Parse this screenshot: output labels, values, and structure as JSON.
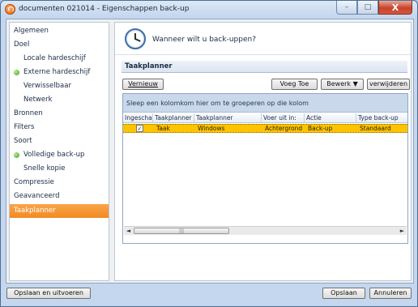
{
  "window": {
    "title": "documenten 021014 - Eigenschappen back-up",
    "minimize_glyph": "–",
    "maximize_glyph": "□",
    "close_glyph": "X"
  },
  "sidebar": {
    "items": [
      {
        "label": "Algemeen",
        "indent": false,
        "dot": false,
        "active": false
      },
      {
        "label": "Doel",
        "indent": false,
        "dot": false,
        "active": false
      },
      {
        "label": "Locale hardeschijf",
        "indent": true,
        "dot": false,
        "active": false
      },
      {
        "label": "Externe hardeschijf",
        "indent": true,
        "dot": true,
        "active": false
      },
      {
        "label": "Verwisselbaar",
        "indent": true,
        "dot": false,
        "active": false
      },
      {
        "label": "Netwerk",
        "indent": true,
        "dot": false,
        "active": false
      },
      {
        "label": "Bronnen",
        "indent": false,
        "dot": false,
        "active": false
      },
      {
        "label": "Filters",
        "indent": false,
        "dot": false,
        "active": false
      },
      {
        "label": "Soort",
        "indent": false,
        "dot": false,
        "active": false
      },
      {
        "label": "Volledige back-up",
        "indent": true,
        "dot": true,
        "active": false
      },
      {
        "label": "Snelle kopie",
        "indent": true,
        "dot": false,
        "active": false
      },
      {
        "label": "Compressie",
        "indent": false,
        "dot": false,
        "active": false
      },
      {
        "label": "Geavanceerd",
        "indent": false,
        "dot": false,
        "active": false
      },
      {
        "label": "Taakplanner",
        "indent": false,
        "dot": false,
        "active": true
      }
    ]
  },
  "main": {
    "question": "Wanneer wilt u back-uppen?",
    "section_title": "Taakplanner",
    "refresh_button": "Vernieuw",
    "add_button": "Voeg Toe",
    "edit_button": "Bewerk",
    "edit_arrow": "▼",
    "delete_button": "verwijderen",
    "group_hint": "Sleep een kolomkom hier om te groeperen op die kolom",
    "columns": [
      "Ingeschak",
      "Taakplanner",
      "Taakplanner",
      "Voer uit in:",
      "Actie",
      "Type back-up"
    ],
    "rows": [
      {
        "checked": "✓",
        "cells": [
          "Taak",
          "Windows",
          "Achtergrond",
          "Back-up",
          "Standaard"
        ]
      }
    ],
    "scroll_left": "◄",
    "scroll_right": "►",
    "scroll_thumb_grip": "|||"
  },
  "footer": {
    "save_run": "Opslaan en uitvoeren",
    "save": "Opslaan",
    "cancel": "Annuleren"
  },
  "colors": {
    "active_item": "#f28a22",
    "selected_row": "#ffc400",
    "accent_blue": "#3d6ea8"
  }
}
